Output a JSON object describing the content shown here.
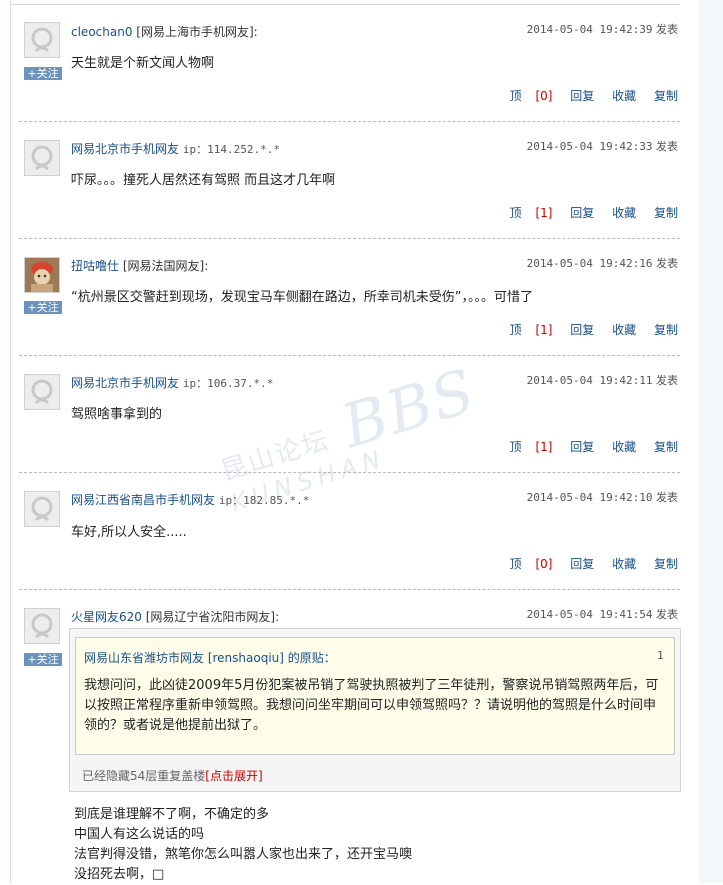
{
  "follow_label": "+关注",
  "action_labels": {
    "top": "顶",
    "reply": "回复",
    "favorite": "收藏",
    "copy": "复制"
  },
  "posts": [
    {
      "name": "cleochan0",
      "location": "[网易上海市手机网友]:",
      "ip": "",
      "time": "2014-05-04 19:42:39",
      "time_suffix": "发表",
      "content": "天生就是个新文闻人物啊",
      "top_count": "[0]"
    },
    {
      "name": "网易北京市手机网友",
      "location": "",
      "ip": "ip：114.252.*.*",
      "time": "2014-05-04 19:42:33",
      "time_suffix": "发表",
      "content": "吓尿。。。撞死人居然还有驾照 而且这才几年啊",
      "top_count": "[1]"
    },
    {
      "name": "扭咕噜仕",
      "location": "[网易法国网友]:",
      "ip": "",
      "time": "2014-05-04 19:42:16",
      "time_suffix": "发表",
      "content": "“杭州景区交警赶到现场，发现宝马车侧翻在路边，所幸司机未受伤”，。。。可惜了",
      "top_count": "[1]"
    },
    {
      "name": "网易北京市手机网友",
      "location": "",
      "ip": "ip：106.37.*.*",
      "time": "2014-05-04 19:42:11",
      "time_suffix": "发表",
      "content": "驾照啥事拿到的",
      "top_count": "[1]"
    },
    {
      "name": "网易江西省南昌市手机网友",
      "location": "",
      "ip": "ip：182.85.*.*",
      "time": "2014-05-04 19:42:10",
      "time_suffix": "发表",
      "content": "车好,所以人安全.....",
      "top_count": "[0]"
    },
    {
      "name": "火星网友620",
      "location": "[网易辽宁省沈阳市网友]:",
      "ip": "",
      "time": "2014-05-04 19:41:54",
      "time_suffix": "发表",
      "content": "",
      "top_count": ""
    }
  ],
  "quote": {
    "author": "网易山东省潍坊市网友 [renshaoqiu] 的原贴：",
    "floor": "1",
    "body": "我想问问，此凶徒2009年5月份犯案被吊销了驾驶执照被判了三年徒刑，警察说吊销驾照两年后，可以按照正常程序重新申领驾照。我想问问坐牢期间可以申领驾照吗？？请说明他的驾照是什么时间申领的？或者说是他提前出狱了。",
    "hidden_note": "已经隐藏54层重复盖楼",
    "expand_link": "[点击展开]"
  },
  "reply_lines": [
    "到底是谁理解不了啊，不确定的多",
    "中国人有这么说话的吗",
    "法官判得没错，煞笔你怎么叫嚣人家也出来了，还开宝马噢",
    "没招死去啊，□"
  ],
  "watermark": {
    "small": "昆山论坛",
    "big": "BBS",
    "sub": "KUNSHAN"
  }
}
